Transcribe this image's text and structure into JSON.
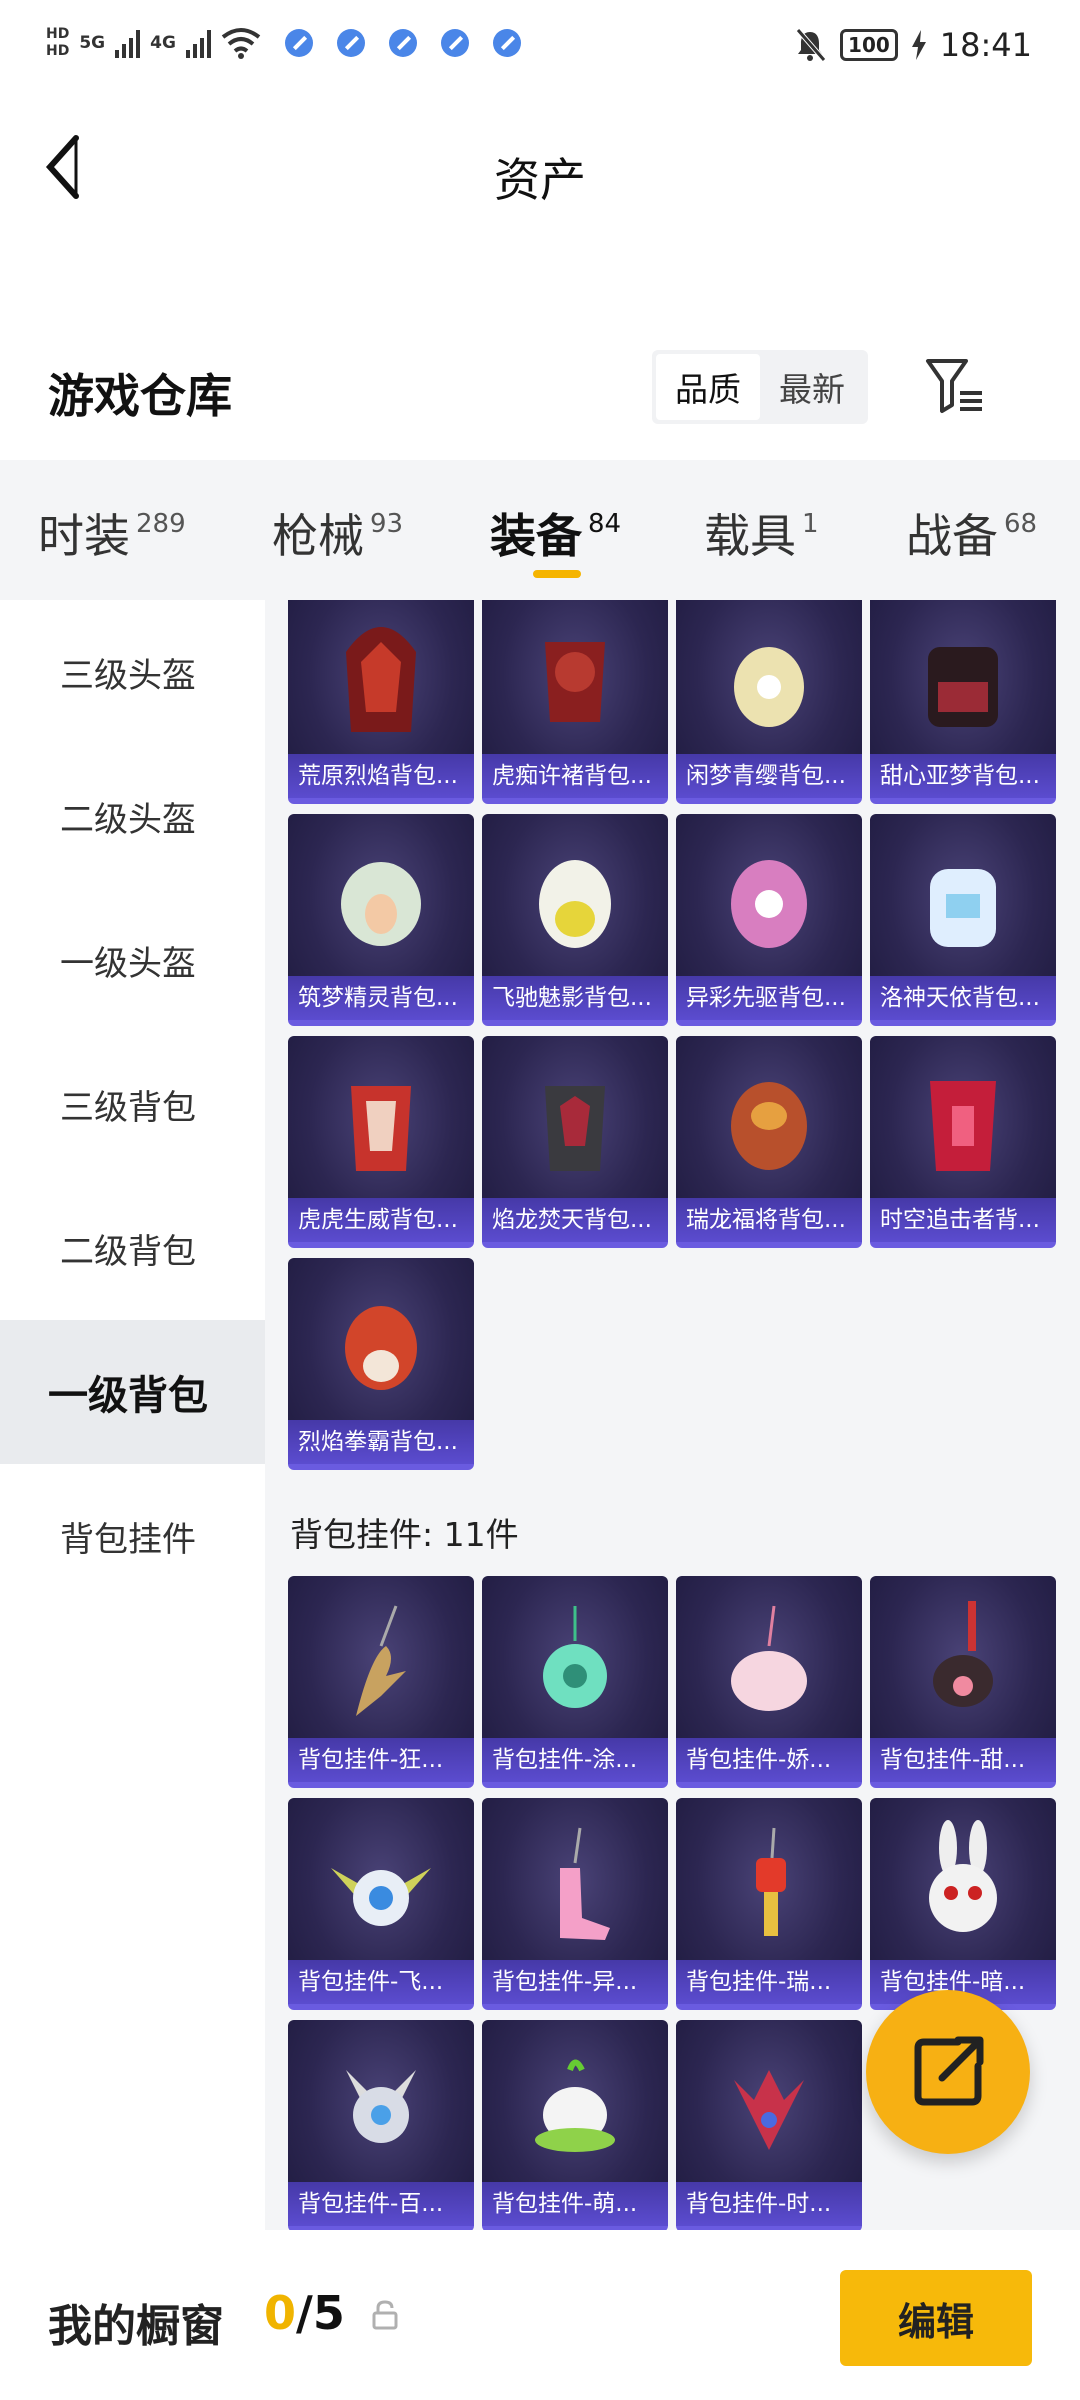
{
  "status_bar": {
    "hd_top": "HD",
    "hd_bottom": "HD",
    "net_5g": "5G",
    "net_4g": "4G",
    "battery": "100",
    "time": "18:41"
  },
  "nav": {
    "title": "资产"
  },
  "warehouse": {
    "title": "游戏仓库",
    "sort_options": [
      "品质",
      "最新"
    ],
    "active_sort": "品质"
  },
  "tabs": [
    {
      "label": "时装",
      "count": "289"
    },
    {
      "label": "枪械",
      "count": "93"
    },
    {
      "label": "装备",
      "count": "84"
    },
    {
      "label": "载具",
      "count": "1"
    },
    {
      "label": "战备",
      "count": "68"
    }
  ],
  "active_tab": "装备",
  "categories": [
    "三级头盔",
    "二级头盔",
    "一级头盔",
    "三级背包",
    "二级背包",
    "一级背包",
    "背包挂件"
  ],
  "active_category": "一级背包",
  "backpacks": [
    "荒原烈焰背包...",
    "虎痴许褚背包...",
    "闲梦青缨背包...",
    "甜心亚梦背包...",
    "筑梦精灵背包...",
    "飞驰魅影背包...",
    "异彩先驱背包...",
    "洛神天依背包...",
    "虎虎生威背包...",
    "焰龙焚天背包...",
    "瑞龙福将背包...",
    "时空追击者背...",
    "烈焰拳霸背包..."
  ],
  "pendant_section": "背包挂件: 11件",
  "pendants": [
    "背包挂件-狂...",
    "背包挂件-涂...",
    "背包挂件-娇...",
    "背包挂件-甜...",
    "背包挂件-飞...",
    "背包挂件-异...",
    "背包挂件-瑞...",
    "背包挂件-暗...",
    "背包挂件-百...",
    "背包挂件-萌...",
    "背包挂件-时..."
  ],
  "showcase": {
    "title": "我的橱窗",
    "current": "0",
    "total": "/5",
    "edit_label": "编辑"
  },
  "colors": {
    "accent": "#f7b90a",
    "card_label": "#5b4ccf",
    "card_bg": "#2c2651"
  }
}
